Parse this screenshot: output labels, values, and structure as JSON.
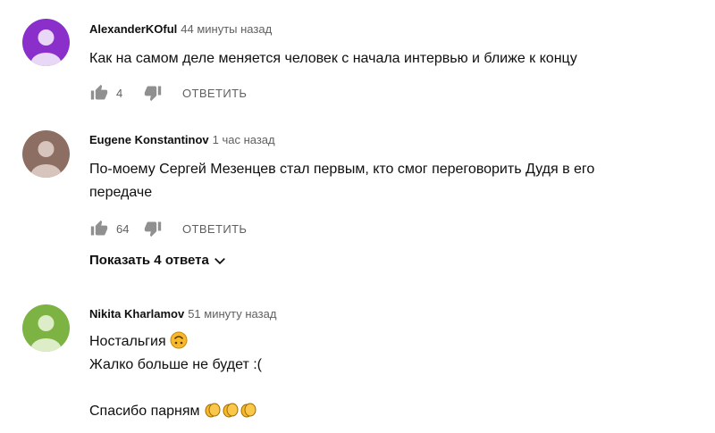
{
  "comments": [
    {
      "author": "AlexanderKOful",
      "time": "44 минуты назад",
      "text": "Как на самом деле меняется человек с начала интервью и ближе к концу",
      "likes": "4",
      "reply_label": "ОТВЕТИТЬ",
      "avatar_color": "#8a2fc9"
    },
    {
      "author": "Eugene Konstantinov",
      "time": "1 час назад",
      "text": "По-моему Сергей Мезенцев стал первым, кто смог переговорить Дудя в его\nпередаче",
      "likes": "64",
      "reply_label": "ОТВЕТИТЬ",
      "show_replies": "Показать 4 ответа",
      "avatar_color": "#8d6e63"
    },
    {
      "author": "Nikita Kharlamov",
      "time": "51 минуту назад",
      "line1": "Ностальгия",
      "line2": "Жалко больше не будет :(",
      "line3": "Спасибо парням",
      "avatar_color": "#7cb342",
      "emoji_line1": "upside-down-face-emoji",
      "emoji_line3": "clapping-hands-emoji x3"
    }
  ],
  "colors": {
    "secondary_text": "#606060",
    "primary_text": "#0f0f0f"
  }
}
